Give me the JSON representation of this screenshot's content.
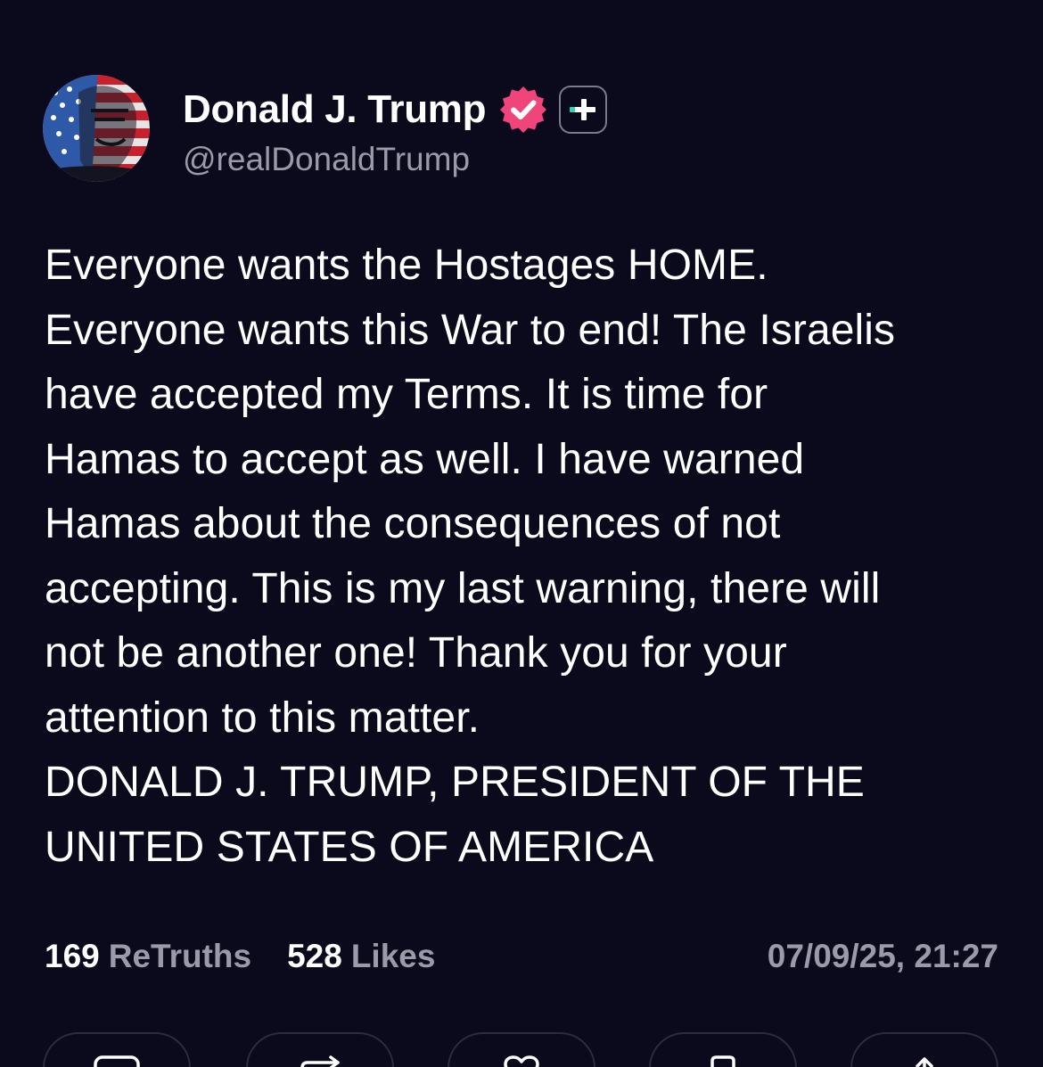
{
  "author": {
    "display_name": "Donald J. Trump",
    "handle": "@realDonaldTrump",
    "avatar_icon": "flag-portrait-avatar",
    "verified_icon": "verified-badge-icon",
    "verified_color": "#f0457a",
    "plus_icon": "plus-subscriber-icon",
    "plus_accent_color": "#2fd3b5"
  },
  "post": {
    "text": "Everyone wants the Hostages HOME.\nEveryone wants this War to end! The Israelis\nhave accepted my Terms. It is time for\nHamas to accept as well. I have warned\nHamas about the consequences of not\naccepting. This is my last warning, there will\nnot be another one! Thank you for your\nattention to this matter.\nDONALD J. TRUMP, PRESIDENT OF THE\nUNITED STATES OF AMERICA"
  },
  "stats": {
    "retruths_count": "169",
    "retruths_label": "ReTruths",
    "likes_count": "528",
    "likes_label": "Likes",
    "timestamp": "07/09/25, 21:27"
  },
  "actions": [
    {
      "icon": "reply-icon"
    },
    {
      "icon": "retruth-icon"
    },
    {
      "icon": "like-icon"
    },
    {
      "icon": "bookmark-icon"
    },
    {
      "icon": "share-icon"
    }
  ],
  "colors": {
    "background": "#0b0a1c",
    "primary_text": "#ffffff",
    "secondary_text": "#9a9aa8",
    "button_border": "#2c2b44"
  }
}
